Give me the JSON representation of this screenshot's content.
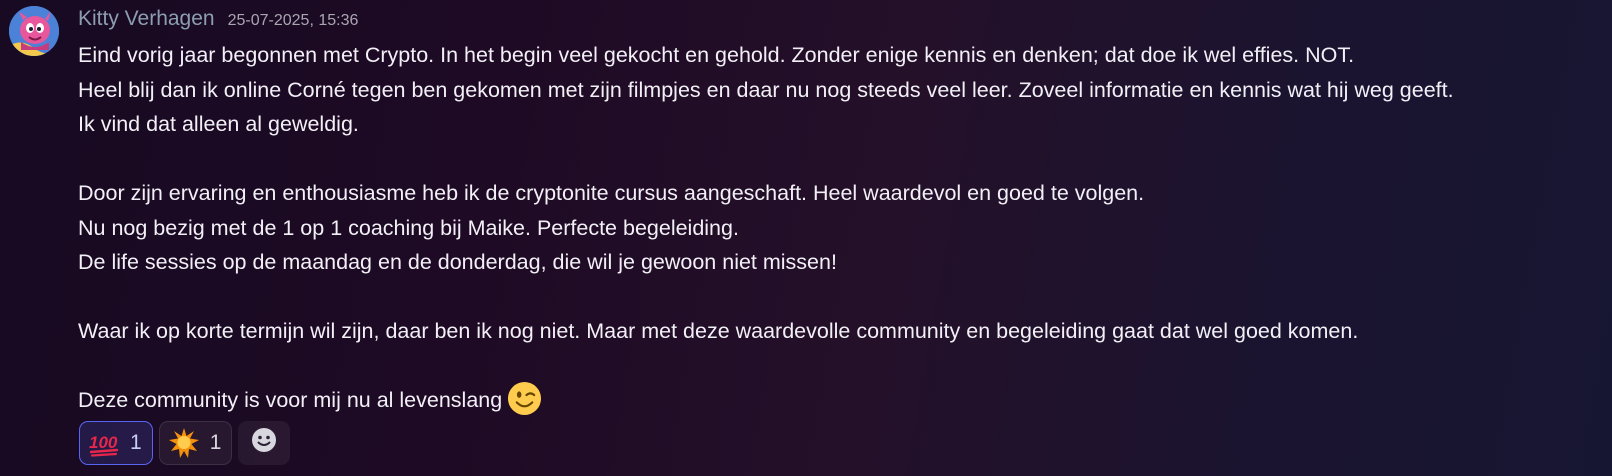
{
  "message": {
    "author": "Kitty Verhagen",
    "timestamp": "25-07-2025, 15:36",
    "avatar_icon": "pink-character-avatar",
    "lines": [
      "Eind vorig jaar begonnen met Crypto. In het begin veel gekocht en gehold. Zonder enige kennis en denken; dat doe ik wel effies. NOT.",
      "Heel blij dan ik online Corné tegen ben gekomen met zijn filmpjes en daar nu nog steeds veel leer. Zoveel informatie en kennis wat hij weg geeft.",
      "Ik vind dat alleen al geweldig.",
      "",
      "Door zijn ervaring en enthousiasme heb ik de cryptonite cursus aangeschaft. Heel waardevol en goed te volgen.",
      "Nu nog bezig met de 1 op 1 coaching bij Maike. Perfecte begeleiding.",
      "De life sessies op de maandag en de donderdag, die wil je gewoon niet missen!",
      "",
      "Waar ik op korte termijn wil zijn, daar ben ik nog niet. Maar met deze waardevolle community en begeleiding gaat dat wel goed komen.",
      "",
      "Deze community is voor mij nu al levenslang"
    ],
    "final_emoji": "winking-face-emoji"
  },
  "reactions": [
    {
      "icon": "hundred-points-emoji",
      "count": "1",
      "active": true
    },
    {
      "icon": "sun-burst-emoji",
      "count": "1",
      "active": false
    }
  ],
  "add_reaction_icon": "smiley-add-reaction-icon",
  "colors": {
    "username": "#8d9db2",
    "active_reaction_border": "#5865f2",
    "text": "#f2f0f6"
  }
}
